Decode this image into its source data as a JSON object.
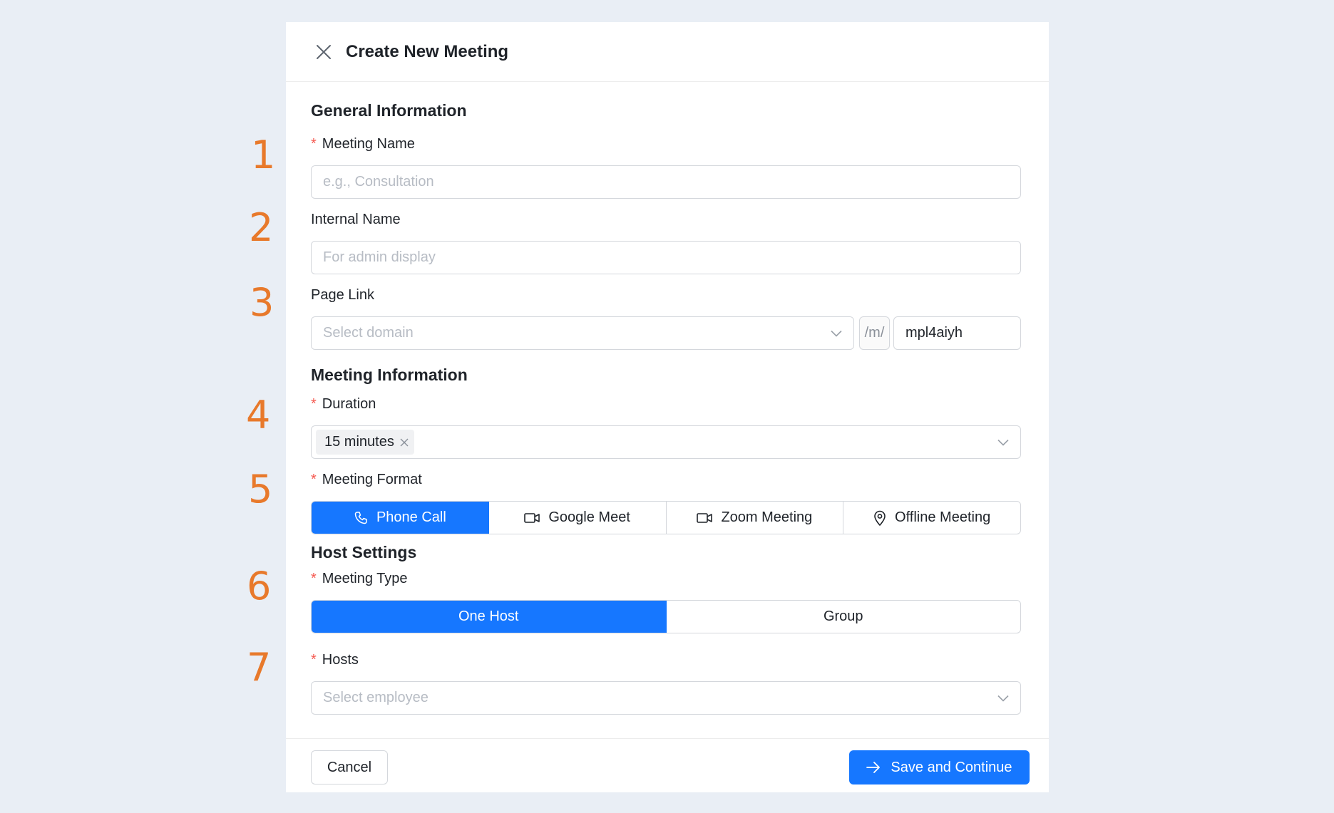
{
  "annotations": [
    "1",
    "2",
    "3",
    "4",
    "5",
    "6",
    "7"
  ],
  "modal": {
    "title": "Create New Meeting",
    "sections": {
      "general": "General Information",
      "meeting": "Meeting Information",
      "host": "Host Settings"
    },
    "required_mark": "*",
    "fields": {
      "meeting_name": {
        "label": "Meeting Name",
        "placeholder": "e.g., Consultation",
        "value": ""
      },
      "internal_name": {
        "label": "Internal Name",
        "placeholder": "For admin display",
        "value": ""
      },
      "page_link": {
        "label": "Page Link",
        "domain_placeholder": "Select domain",
        "path_prefix": "/m/",
        "slug_value": "mpl4aiyh"
      },
      "duration": {
        "label": "Duration",
        "tags": [
          "15 minutes"
        ]
      },
      "meeting_format": {
        "label": "Meeting Format",
        "options": [
          "Phone Call",
          "Google Meet",
          "Zoom Meeting",
          "Offline Meeting"
        ],
        "selected": "Phone Call"
      },
      "meeting_type": {
        "label": "Meeting Type",
        "options": [
          "One Host",
          "Group"
        ],
        "selected": "One Host"
      },
      "hosts": {
        "label": "Hosts",
        "placeholder": "Select employee"
      }
    },
    "footer": {
      "cancel_label": "Cancel",
      "save_label": "Save and Continue"
    }
  },
  "colors": {
    "accent": "#1677ff",
    "required": "#f5584f",
    "annotation": "#e8792b",
    "background": "#e9eef5"
  }
}
